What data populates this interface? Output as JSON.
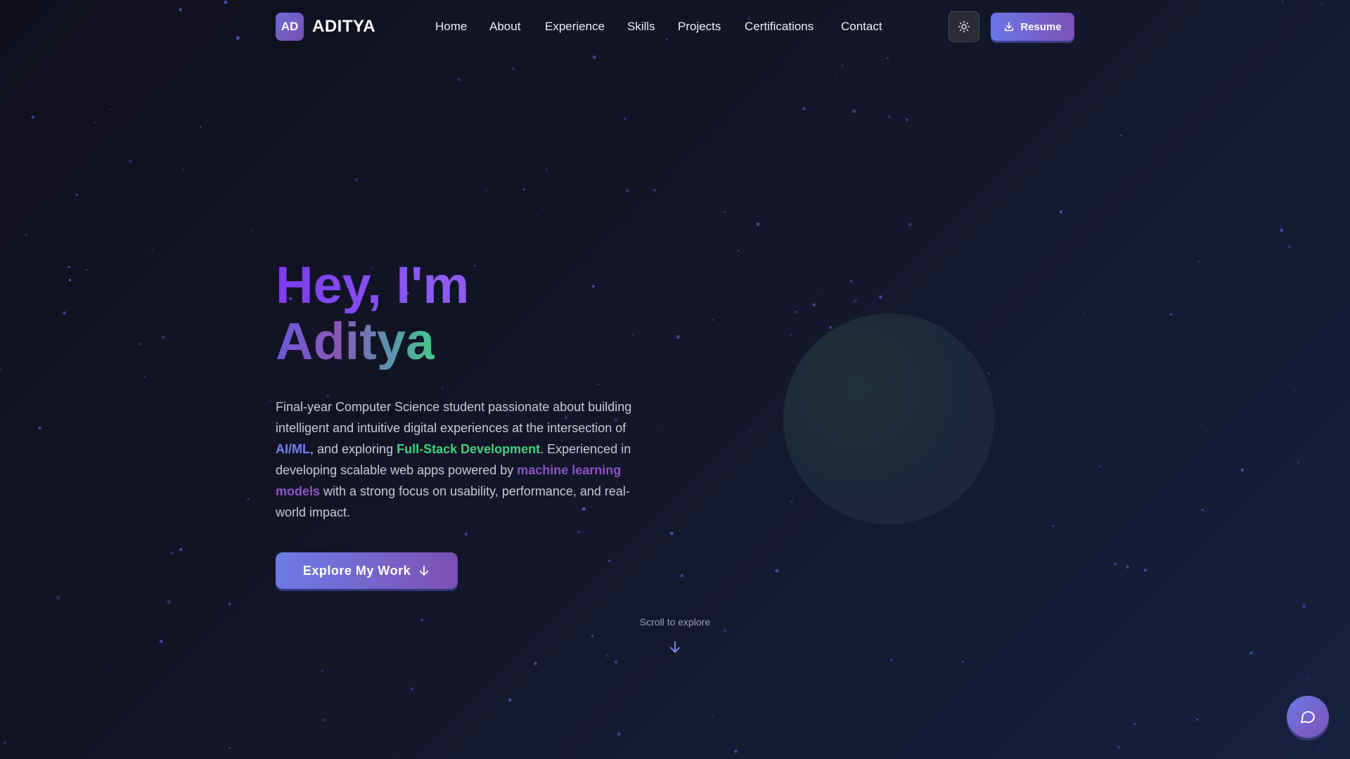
{
  "brand": {
    "badge": "AD",
    "name": "ADITYA"
  },
  "nav": {
    "items": [
      {
        "label": "Home"
      },
      {
        "label": "About"
      },
      {
        "label": "Experience"
      },
      {
        "label": "Skills"
      },
      {
        "label": "Projects"
      },
      {
        "label": "Certifications"
      },
      {
        "label": "Contact"
      }
    ],
    "resume_label": "Resume",
    "theme_icon": "sun-icon",
    "resume_icon": "download-icon"
  },
  "hero": {
    "line1": "Hey, I'm",
    "line2": "Aditya",
    "desc_parts": [
      "Final-year Computer Science student passionate about building intelligent and intuitive digital experiences at the intersection of ",
      "AI/ML",
      ", and exploring ",
      "Full-Stack Development",
      ". Experienced in developing scalable web apps powered by ",
      "machine learning models",
      " with a strong focus on usability, performance, and real-world impact."
    ],
    "cta_label": "Explore My Work",
    "cta_icon": "arrow-down-icon",
    "scroll_label": "Scroll to explore"
  },
  "chat": {
    "icon": "chat-bubble-icon"
  },
  "colors": {
    "background": "#131528",
    "accent_blue": "#7281f2",
    "accent_green": "#44d17f",
    "accent_purple": "#8a55c4",
    "button_gradient_start": "#6c75e6",
    "button_gradient_end": "#7b52b8"
  }
}
